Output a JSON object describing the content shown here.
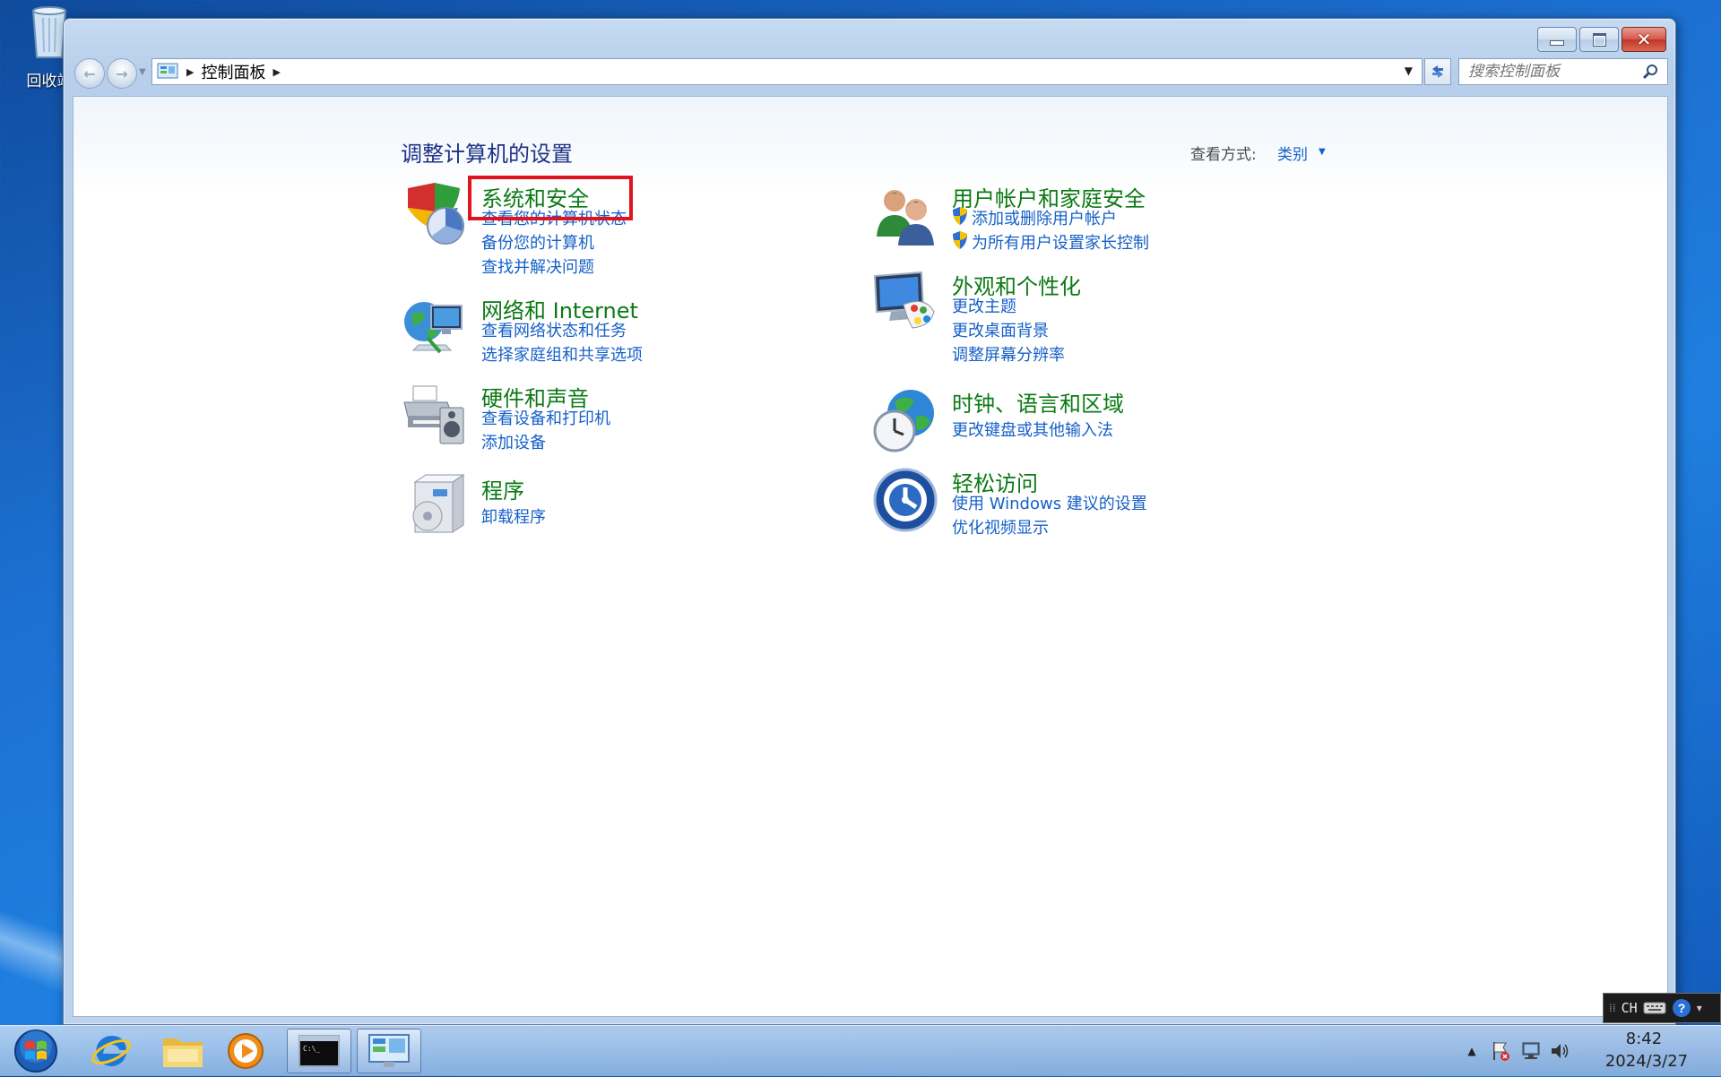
{
  "desktop": {
    "recycle_bin_label": "回收站"
  },
  "window": {
    "address": {
      "segment": "控制面板"
    },
    "search": {
      "placeholder": "搜索控制面板"
    },
    "content": {
      "title": "调整计算机的设置",
      "view_by_label": "查看方式:",
      "view_by_value": "类别",
      "categories": [
        {
          "title": "系统和安全",
          "icon": "shield-pie-chart-icon",
          "links": [
            "查看您的计算机状态",
            "备份您的计算机",
            "查找并解决问题"
          ]
        },
        {
          "title": "网络和 Internet",
          "icon": "network-globe-icon",
          "links": [
            "查看网络状态和任务",
            "选择家庭组和共享选项"
          ]
        },
        {
          "title": "硬件和声音",
          "icon": "printer-speaker-icon",
          "links": [
            "查看设备和打印机",
            "添加设备"
          ]
        },
        {
          "title": "程序",
          "icon": "programs-box-icon",
          "links": [
            "卸载程序"
          ]
        },
        {
          "title": "用户帐户和家庭安全",
          "icon": "users-icon",
          "links": [
            "添加或删除用户帐户",
            "为所有用户设置家长控制"
          ]
        },
        {
          "title": "外观和个性化",
          "icon": "monitor-palette-icon",
          "links": [
            "更改主题",
            "更改桌面背景",
            "调整屏幕分辨率"
          ]
        },
        {
          "title": "时钟、语言和区域",
          "icon": "clock-globe-icon",
          "links": [
            "更改键盘或其他输入法"
          ]
        },
        {
          "title": "轻松访问",
          "icon": "ease-of-access-icon",
          "links": [
            "使用 Windows 建议的设置",
            "优化视频显示"
          ]
        }
      ]
    }
  },
  "taskbar": {
    "clock_time": "8:42",
    "clock_date": "2024/3/27",
    "language": "CH",
    "items": [
      "internet-explorer-icon",
      "explorer-folder-icon",
      "media-player-icon",
      "command-prompt-icon",
      "control-panel-icon"
    ]
  },
  "colors": {
    "category_title": "#0b7a14",
    "link": "#1560c8",
    "page_title": "#1e3287",
    "highlight": "#e0141e"
  }
}
